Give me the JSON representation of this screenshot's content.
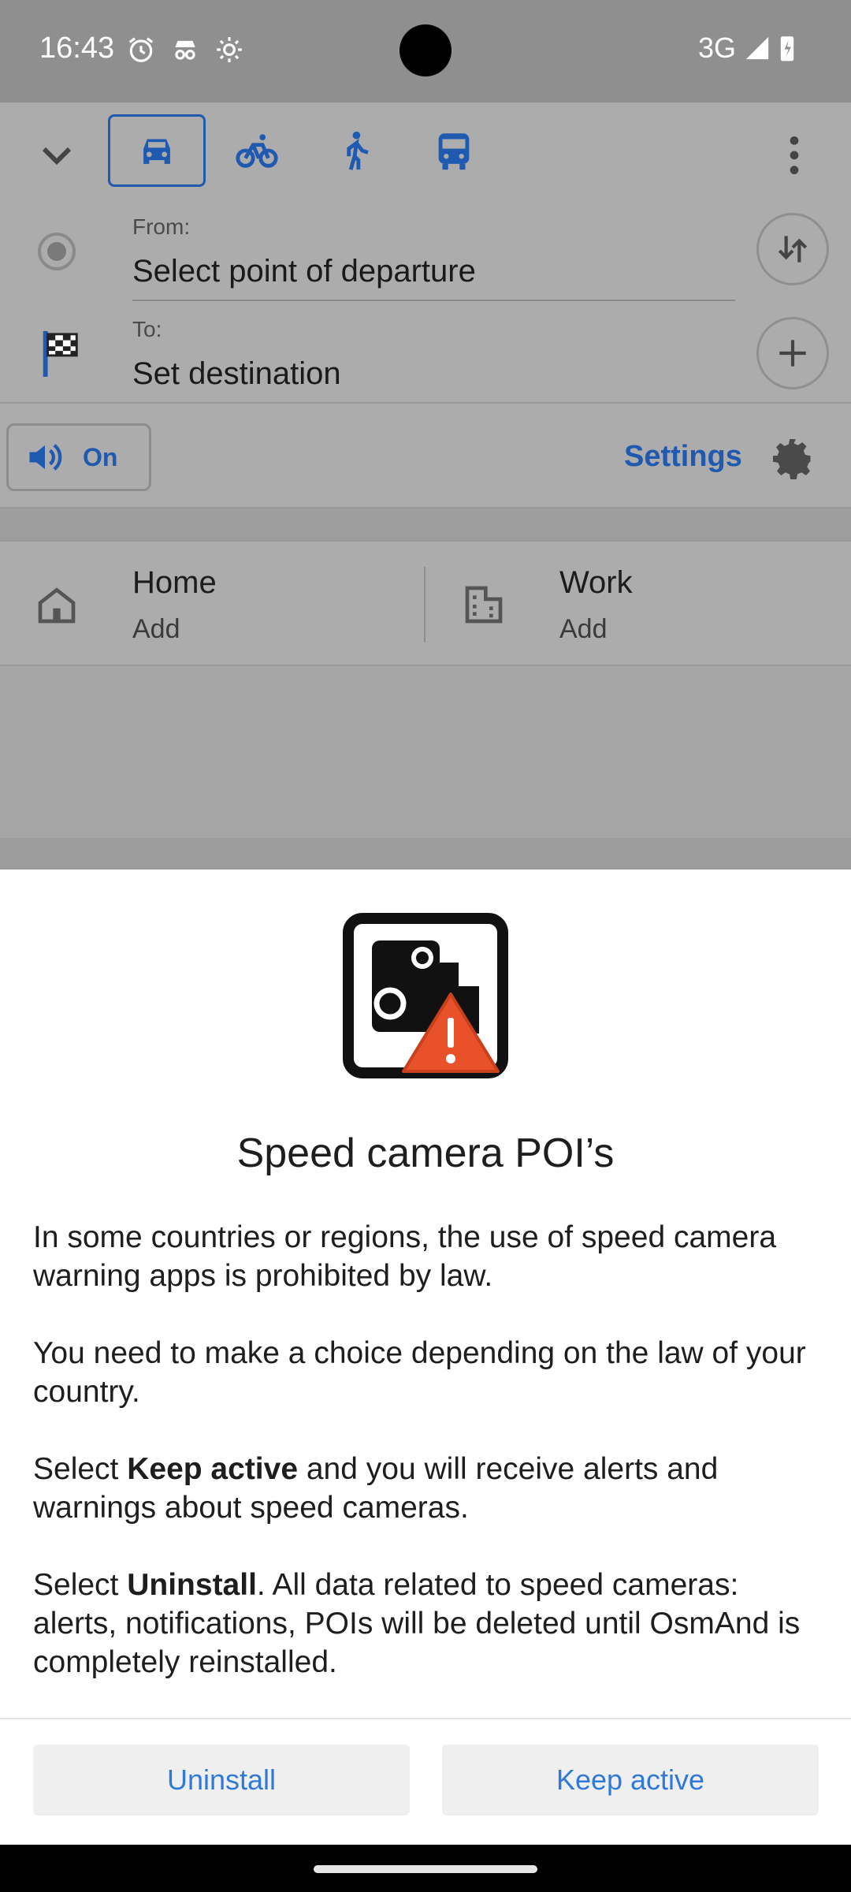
{
  "status_bar": {
    "time": "16:43",
    "network": "3G",
    "icons": [
      "alarm-icon",
      "incognito-icon",
      "settings-icon",
      "signal-icon",
      "battery-charging-icon"
    ]
  },
  "route": {
    "modes": [
      "car-icon",
      "bicycle-icon",
      "pedestrian-icon",
      "bus-icon"
    ],
    "selected_mode": "car-icon",
    "from_label": "From:",
    "from_value": "Select point of departure",
    "to_label": "To:",
    "to_value": "Set destination",
    "voice_label": "On",
    "settings_label": "Settings"
  },
  "places": {
    "home_title": "Home",
    "home_sub": "Add",
    "work_title": "Work",
    "work_sub": "Add"
  },
  "dialog": {
    "title": "Speed camera POI’s",
    "para1": "In some countries or regions, the use of speed camera warning apps is prohibited by law.",
    "para2": "You need to make a choice depending on the law of your country.",
    "para3_pre": "Select ",
    "para3_bold": "Keep active",
    "para3_post": " and you will receive alerts and warnings about speed cameras.",
    "para4_pre": "Select ",
    "para4_bold": "Uninstall",
    "para4_post": ". All data related to speed cameras: alerts, notifications, POIs will be deleted until OsmAnd is completely reinstalled.",
    "uninstall_label": "Uninstall",
    "keep_label": "Keep active"
  },
  "colors": {
    "accent": "#2f7ad9",
    "dim_accent": "#1f5ab0",
    "warning": "#e8512a"
  }
}
